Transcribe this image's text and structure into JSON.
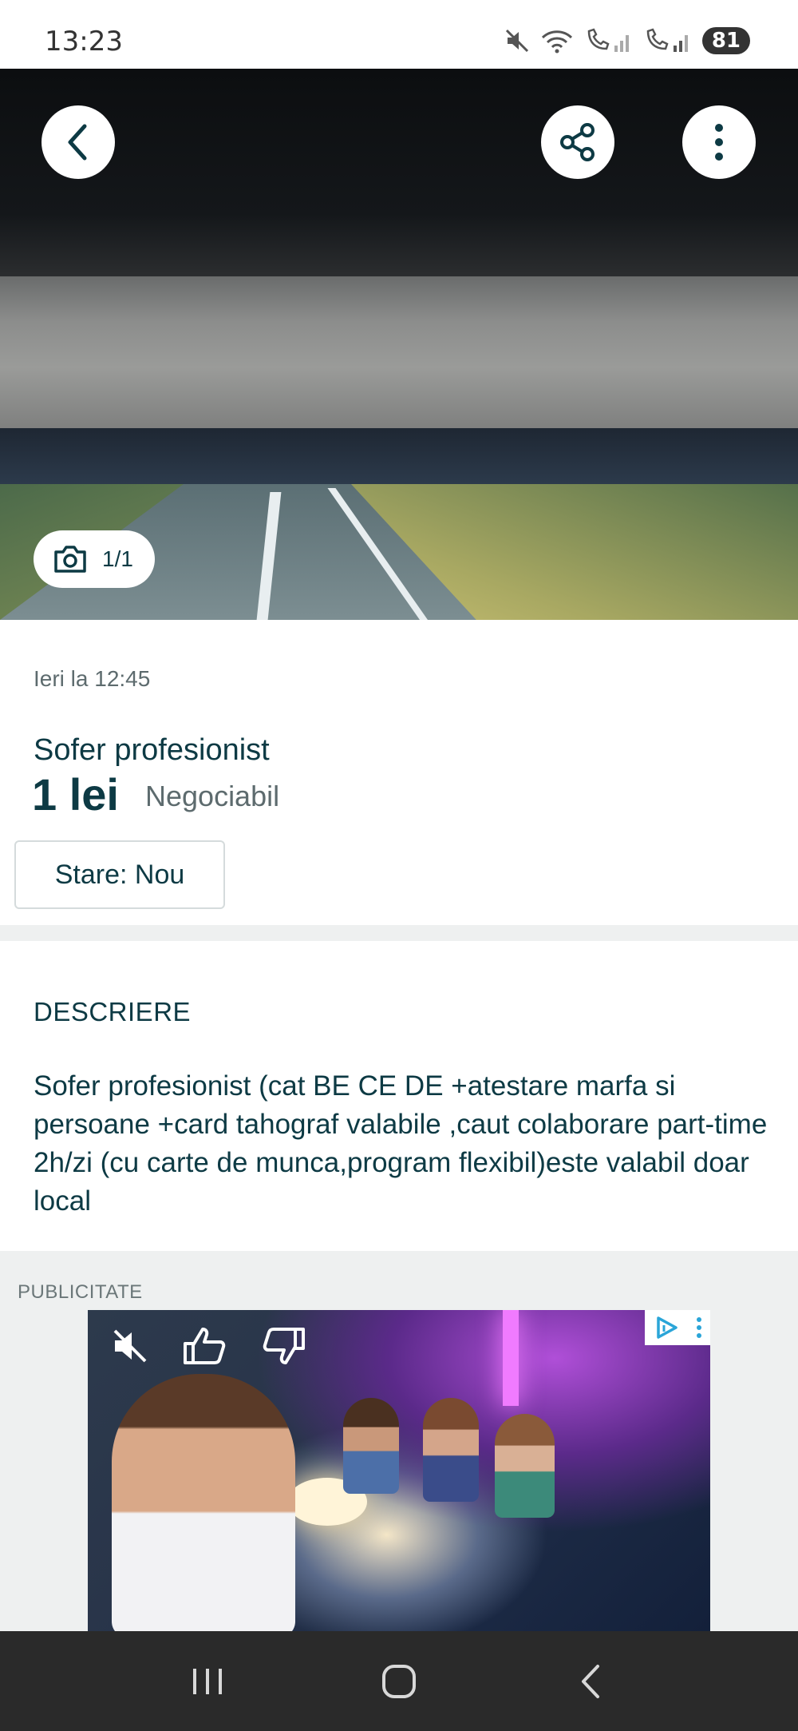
{
  "status_bar": {
    "time": "13:23",
    "battery": "81"
  },
  "listing": {
    "photo_counter": "1/1",
    "posted": "Ieri la 12:45",
    "title": "Sofer profesionist",
    "price": "1 lei",
    "negotiable": "Negociabil",
    "condition": "Stare: Nou"
  },
  "description": {
    "heading": "DESCRIERE",
    "text": "Sofer profesionist (cat BE CE DE +atestare marfa si persoane +card tahograf valabile ,caut colaborare part-time 2h/zi (cu carte de munca,program flexibil)este valabil doar local"
  },
  "ad": {
    "label": "PUBLICITATE"
  },
  "icons": {
    "back": "chevron-left-icon",
    "share": "share-icon",
    "more": "more-vertical-icon",
    "camera": "camera-icon",
    "mute": "volume-muted-icon",
    "like": "thumbs-up-icon",
    "dislike": "thumbs-down-icon"
  },
  "colors": {
    "text_primary": "#0d3a44",
    "text_secondary": "#5d6b6e",
    "divider": "#eef0f0"
  }
}
